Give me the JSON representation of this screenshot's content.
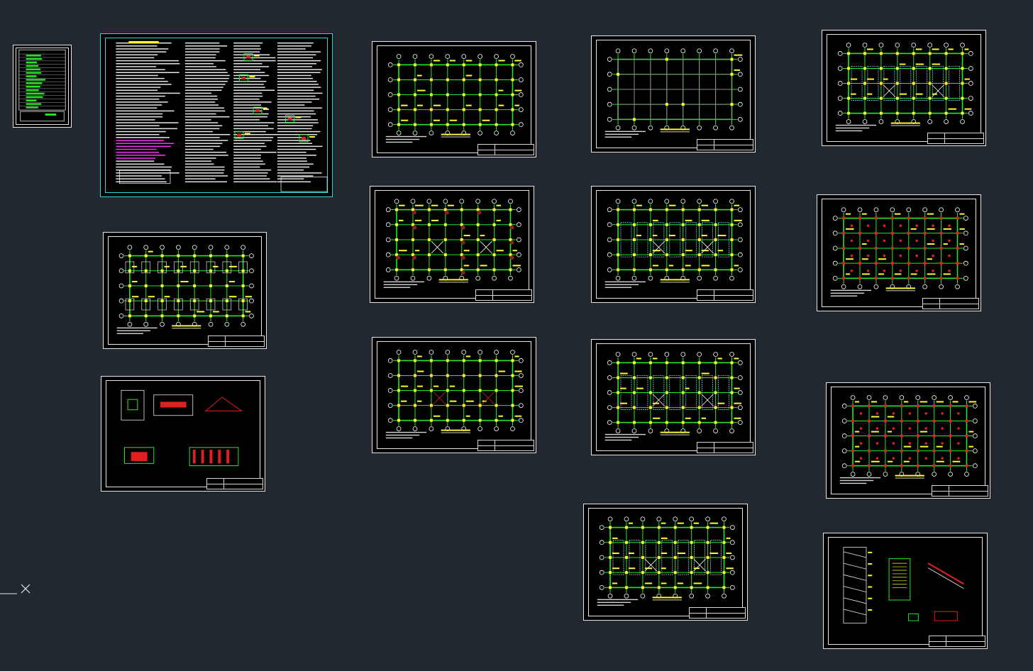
{
  "app": {
    "title": "",
    "background_color": "#212830"
  },
  "colors": {
    "sheet_border": "#e8e8e8",
    "selected_border": "#2fd6de",
    "grid_line": "#27e827",
    "axis_bubble": "#ffffff",
    "annotation": "#ffff33",
    "highlight_magenta": "#ff33ff",
    "section_red": "#e02020",
    "beam_cyan": "#7fd0e0"
  },
  "sheets": [
    {
      "id": "index-table",
      "kind": "index",
      "selected": false
    },
    {
      "id": "design-notes",
      "kind": "notes",
      "selected": true
    },
    {
      "id": "foundation-plan",
      "kind": "foundation",
      "selected": false
    },
    {
      "id": "foundation-details",
      "kind": "details",
      "selected": false
    },
    {
      "id": "column-plan-1",
      "kind": "plan",
      "variant": "plain",
      "selected": false
    },
    {
      "id": "column-plan-2",
      "kind": "plan",
      "variant": "redmarks",
      "selected": false
    },
    {
      "id": "column-plan-3",
      "kind": "plan",
      "variant": "redx",
      "selected": false
    },
    {
      "id": "floor-plan-grey",
      "kind": "plan",
      "variant": "grey",
      "selected": false
    },
    {
      "id": "beam-plan-2",
      "kind": "plan",
      "variant": "cyan",
      "selected": false
    },
    {
      "id": "beam-plan-3",
      "kind": "plan",
      "variant": "cyan",
      "selected": false
    },
    {
      "id": "beam-plan-4",
      "kind": "plan",
      "variant": "grey-beams",
      "selected": false
    },
    {
      "id": "roof-plan-1",
      "kind": "plan",
      "variant": "cyan-x",
      "selected": false
    },
    {
      "id": "slab-plan-1",
      "kind": "plan",
      "variant": "red-dots",
      "selected": false
    },
    {
      "id": "slab-plan-2",
      "kind": "plan",
      "variant": "red-dots",
      "selected": false
    },
    {
      "id": "stair-details",
      "kind": "stairs",
      "selected": false
    }
  ],
  "ucs_icon": "ucs-axis-icon"
}
